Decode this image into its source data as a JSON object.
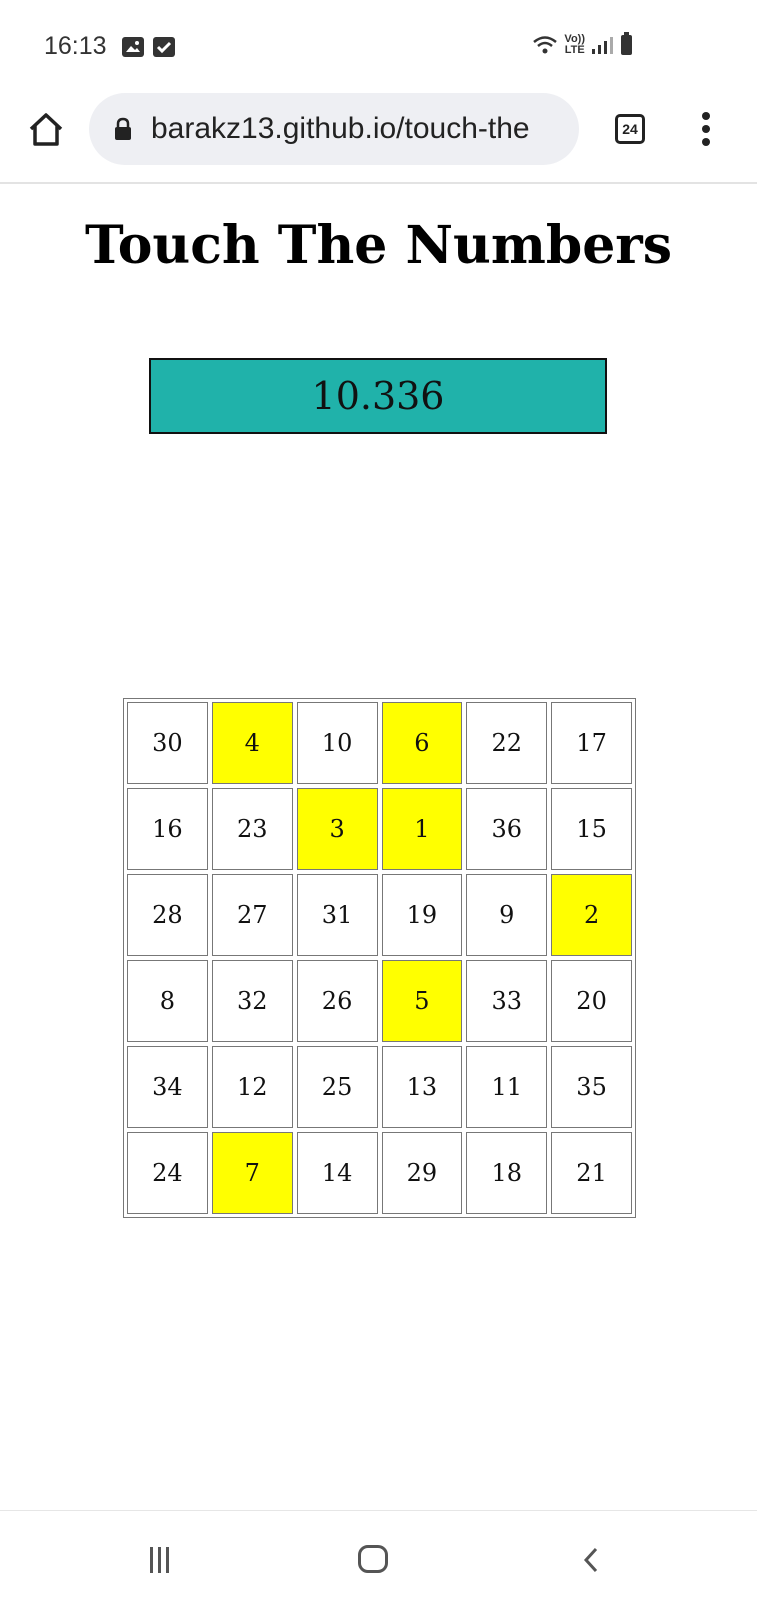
{
  "status_bar": {
    "time": "16:13",
    "network_label": "Vo))\nLTE"
  },
  "browser": {
    "url": "barakz13.github.io/touch-the",
    "tab_count": "24"
  },
  "page": {
    "title": "Touch The Numbers",
    "timer": "10.336"
  },
  "board": {
    "rows": [
      [
        {
          "n": "30",
          "found": false
        },
        {
          "n": "4",
          "found": true
        },
        {
          "n": "10",
          "found": false
        },
        {
          "n": "6",
          "found": true
        },
        {
          "n": "22",
          "found": false
        },
        {
          "n": "17",
          "found": false
        }
      ],
      [
        {
          "n": "16",
          "found": false
        },
        {
          "n": "23",
          "found": false
        },
        {
          "n": "3",
          "found": true
        },
        {
          "n": "1",
          "found": true
        },
        {
          "n": "36",
          "found": false
        },
        {
          "n": "15",
          "found": false
        }
      ],
      [
        {
          "n": "28",
          "found": false
        },
        {
          "n": "27",
          "found": false
        },
        {
          "n": "31",
          "found": false
        },
        {
          "n": "19",
          "found": false
        },
        {
          "n": "9",
          "found": false
        },
        {
          "n": "2",
          "found": true
        }
      ],
      [
        {
          "n": "8",
          "found": false
        },
        {
          "n": "32",
          "found": false
        },
        {
          "n": "26",
          "found": false
        },
        {
          "n": "5",
          "found": true
        },
        {
          "n": "33",
          "found": false
        },
        {
          "n": "20",
          "found": false
        }
      ],
      [
        {
          "n": "34",
          "found": false
        },
        {
          "n": "12",
          "found": false
        },
        {
          "n": "25",
          "found": false
        },
        {
          "n": "13",
          "found": false
        },
        {
          "n": "11",
          "found": false
        },
        {
          "n": "35",
          "found": false
        }
      ],
      [
        {
          "n": "24",
          "found": false
        },
        {
          "n": "7",
          "found": true
        },
        {
          "n": "14",
          "found": false
        },
        {
          "n": "29",
          "found": false
        },
        {
          "n": "18",
          "found": false
        },
        {
          "n": "21",
          "found": false
        }
      ]
    ],
    "found_color": "#ffff00",
    "timer_color": "#20b2aa"
  }
}
